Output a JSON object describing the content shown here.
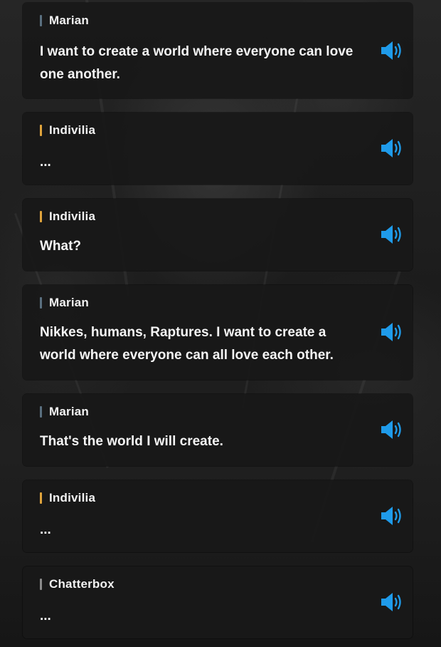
{
  "colors": {
    "marian_bar": "#5a7080",
    "indivilia_bar": "#e0a43c",
    "chatterbox_bar": "#8a8a8a",
    "voice_icon": "#1f9bea"
  },
  "messages": [
    {
      "speaker": "Marian",
      "bar_color": "#5a7080",
      "text": "I want to create a world where everyone can love one another.",
      "voice_icon": "speaker-volume-icon"
    },
    {
      "speaker": "Indivilia",
      "bar_color": "#e0a43c",
      "text": "...",
      "voice_icon": "speaker-volume-icon"
    },
    {
      "speaker": "Indivilia",
      "bar_color": "#e0a43c",
      "text": "What?",
      "voice_icon": "speaker-volume-icon"
    },
    {
      "speaker": "Marian",
      "bar_color": "#5a7080",
      "text": "Nikkes, humans, Raptures. I want to create a world where everyone can all love each other.",
      "voice_icon": "speaker-volume-icon"
    },
    {
      "speaker": "Marian",
      "bar_color": "#5a7080",
      "text": "That's the world I will create.",
      "voice_icon": "speaker-volume-icon"
    },
    {
      "speaker": "Indivilia",
      "bar_color": "#e0a43c",
      "text": "...",
      "voice_icon": "speaker-volume-icon"
    },
    {
      "speaker": "Chatterbox",
      "bar_color": "#8a8a8a",
      "text": "...",
      "voice_icon": "speaker-volume-icon"
    }
  ]
}
